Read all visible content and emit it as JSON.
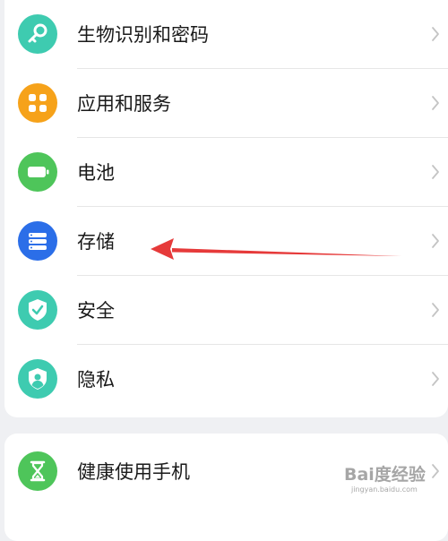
{
  "settings_group": {
    "items": [
      {
        "label": "生物识别和密码",
        "icon": "key-icon",
        "color": "#3ecbb0"
      },
      {
        "label": "应用和服务",
        "icon": "apps-grid-icon",
        "color": "#f6a21a"
      },
      {
        "label": "电池",
        "icon": "battery-icon",
        "color": "#4ec55a"
      },
      {
        "label": "存储",
        "icon": "storage-icon",
        "color": "#2b6ee8"
      },
      {
        "label": "安全",
        "icon": "shield-check-icon",
        "color": "#3ecbb0"
      },
      {
        "label": "隐私",
        "icon": "privacy-shield-icon",
        "color": "#3ecbb0"
      }
    ]
  },
  "health_group": {
    "items": [
      {
        "label": "健康使用手机",
        "icon": "hourglass-icon",
        "color": "#4ec55a"
      }
    ]
  },
  "annotation": {
    "type": "red-arrow",
    "points_to": "存储",
    "color": "#e63a3a"
  },
  "watermark": {
    "text": "Bai度经验",
    "subtext": "jingyan.baidu.com"
  }
}
